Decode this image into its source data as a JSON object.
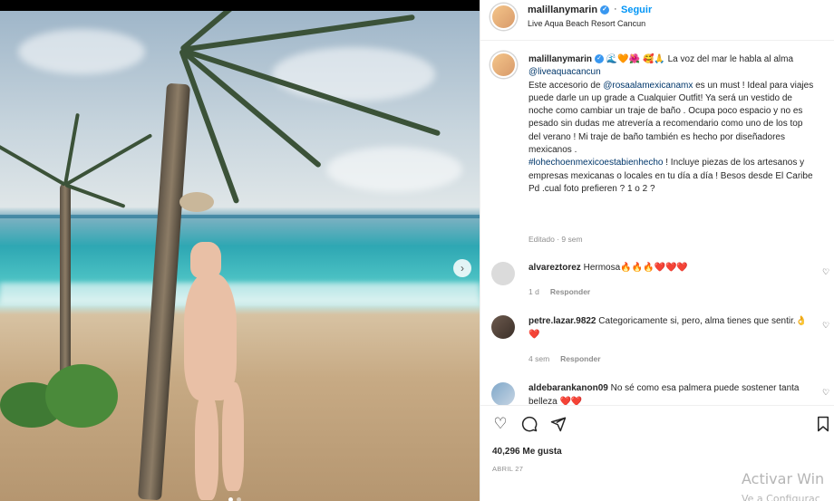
{
  "header": {
    "username": "malillanymarin",
    "follow_label": "Seguir",
    "location": "Live Aqua Beach Resort Cancun"
  },
  "caption": {
    "username": "malillanymarin",
    "line1": "🌊🧡🌺 🥰🙏 La voz del mar le habla al alma",
    "mention": "@liveaquacancun",
    "body1_pre": "Este accesorio de ",
    "mention2": "@rosaalamexicanamx",
    "body1_post": " es un must ! Ideal para viajes puede darle un up grade a Cualquier Outfit! Ya será un vestido de noche como cambiar un traje de baño . Ocupa poco espacio y no es pesado sin dudas me atrevería a recomendario como uno de los top del verano ! Mi traje de baño también es hecho por diseñadores mexicanos .",
    "hashtag": "#lohechoenmexicoestabienhecho",
    "body2": " ! Incluye piezas de los artesanos y empresas mexicanas o locales en tu día a día ! Besos desde El Caribe",
    "body3": "Pd .cual foto prefieren ? 1 o 2 ?",
    "meta": "Editado · 9 sem"
  },
  "comments": [
    {
      "username": "alvareztorez",
      "text": "Hermosa🔥🔥🔥❤️❤️❤️",
      "time": "1 d",
      "reply": "Responder"
    },
    {
      "username": "petre.lazar.9822",
      "text": "Categoricamente si, pero, alma tienes que sentir.👌❤️",
      "time": "4 sem",
      "reply": "Responder"
    },
    {
      "username": "aldebarankanon09",
      "text": "No sé como esa palmera puede sostener tanta belleza ❤️❤️",
      "time": "",
      "reply": ""
    }
  ],
  "actions": {
    "likes": "40,296 Me gusta",
    "date": "ABRIL 27"
  },
  "watermark": {
    "line1": "Activar Win",
    "line2": "Ve a Configurac"
  },
  "icons": {
    "next": "chevron-right-icon",
    "like": "heart-icon",
    "comment": "comment-icon",
    "share": "share-icon",
    "save": "bookmark-icon"
  },
  "colors": {
    "link": "#00376b",
    "follow": "#0095f6",
    "verified": "#3897f0",
    "muted": "#8e8e8e"
  }
}
